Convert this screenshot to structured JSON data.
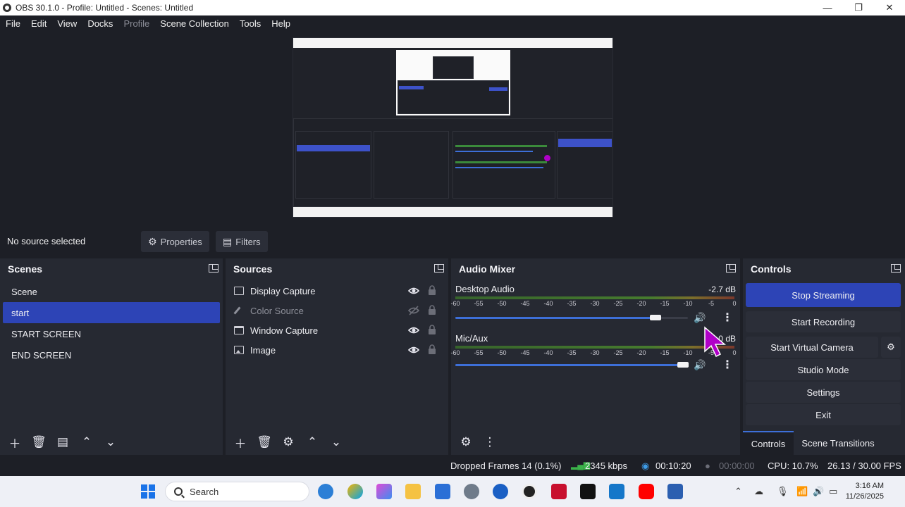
{
  "window": {
    "title": "OBS 30.1.0 - Profile: Untitled - Scenes: Untitled",
    "controls": {
      "minimize": "—",
      "maximize": "❐",
      "close": "✕"
    }
  },
  "menu": {
    "file": "File",
    "edit": "Edit",
    "view": "View",
    "docks": "Docks",
    "profile": "Profile",
    "scene_collection": "Scene Collection",
    "tools": "Tools",
    "help": "Help"
  },
  "properties_bar": {
    "no_source": "No source selected",
    "properties": "Properties",
    "filters": "Filters"
  },
  "scenes": {
    "title": "Scenes",
    "items": [
      {
        "label": "Scene",
        "selected": false
      },
      {
        "label": "start",
        "selected": true
      },
      {
        "label": "START SCREEN",
        "selected": false
      },
      {
        "label": "END SCREEN",
        "selected": false
      }
    ]
  },
  "sources": {
    "title": "Sources",
    "items": [
      {
        "label": "Display Capture",
        "icon": "monitor-icon",
        "visible": true
      },
      {
        "label": "Color Source",
        "icon": "brush-icon",
        "visible": false
      },
      {
        "label": "Window Capture",
        "icon": "window-icon",
        "visible": true
      },
      {
        "label": "Image",
        "icon": "image-icon",
        "visible": true
      }
    ]
  },
  "audio_mixer": {
    "title": "Audio Mixer",
    "ticks": [
      "-60",
      "-55",
      "-50",
      "-45",
      "-40",
      "-35",
      "-30",
      "-25",
      "-20",
      "-15",
      "-10",
      "-5",
      "0"
    ],
    "channels": [
      {
        "name": "Desktop Audio",
        "db": "-2.7 dB",
        "volume": 0.86
      },
      {
        "name": "Mic/Aux",
        "db": "0.0 dB",
        "volume": 0.98
      }
    ]
  },
  "controls": {
    "title": "Controls",
    "stop_streaming": "Stop Streaming",
    "start_recording": "Start Recording",
    "start_virtual_camera": "Start Virtual Camera",
    "studio_mode": "Studio Mode",
    "settings": "Settings",
    "exit": "Exit",
    "tab_controls": "Controls",
    "tab_scene_transitions": "Scene Transitions"
  },
  "status": {
    "dropped_frames": "Dropped Frames 14 (0.1%)",
    "bitrate": "2345 kbps",
    "stream_time": "00:10:20",
    "record_time": "00:00:00",
    "cpu": "CPU: 10.7%",
    "fps": "26.13 / 30.00 FPS"
  },
  "taskbar": {
    "search_placeholder": "Search",
    "time": "3:16 AM",
    "date": "11/26/2025"
  },
  "colors": {
    "accent": "#2d44b6",
    "dock_bg": "#262932",
    "window_bg": "#1d1f26",
    "meter_green": "#4c8a2e",
    "cursor": "#b000c8"
  }
}
